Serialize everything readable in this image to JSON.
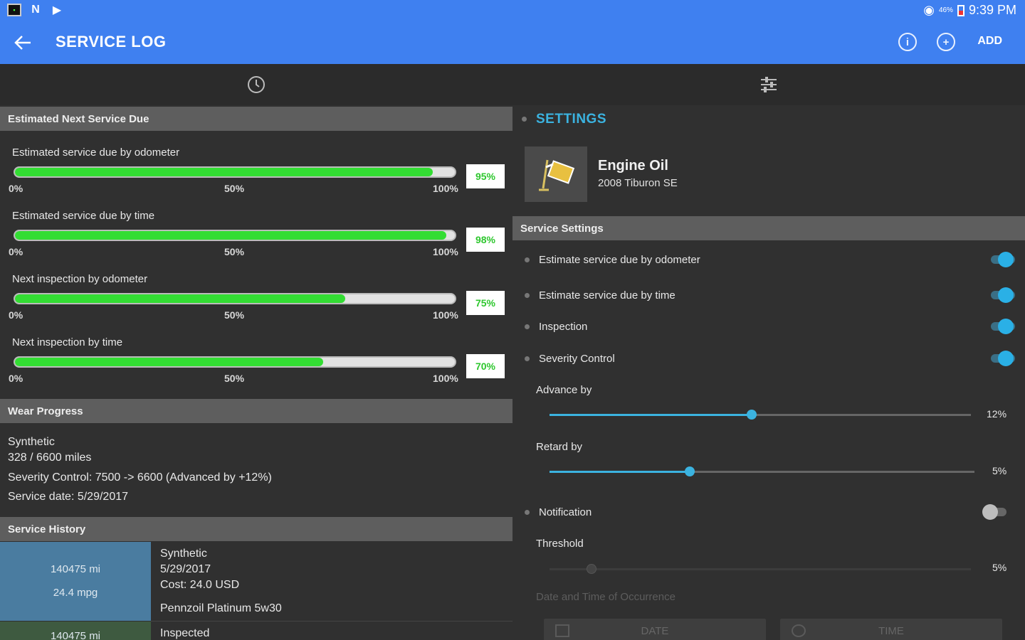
{
  "status_bar": {
    "battery_pct": "46%",
    "time": "9:39 PM"
  },
  "app_bar": {
    "title": "SERVICE LOG",
    "add_label": "ADD",
    "info_icon": "info-icon",
    "add_icon": "add-circle-icon"
  },
  "tabs": [
    {
      "icon": "clock-icon"
    },
    {
      "icon": "sliders-icon"
    }
  ],
  "estimated": {
    "header": "Estimated Next Service Due",
    "ticks": [
      "0%",
      "50%",
      "100%"
    ],
    "bars": [
      {
        "label": "Estimated service due by odometer",
        "value": 0.95,
        "pct": "95%"
      },
      {
        "label": "Estimated service due by time",
        "value": 0.98,
        "pct": "98%"
      },
      {
        "label": "Next inspection by odometer",
        "value": 0.75,
        "pct": "75%"
      },
      {
        "label": "Next inspection by time",
        "value": 0.7,
        "pct": "70%"
      }
    ]
  },
  "wear": {
    "header": "Wear Progress",
    "lines": [
      "Synthetic",
      "328 / 6600 miles",
      "Severity Control: 7500 -> 6600 (Advanced by +12%)",
      "Service date: 5/29/2017"
    ]
  },
  "history": {
    "header": "Service History",
    "entries": [
      {
        "odometer": "140475 mi",
        "mpg": "24.4 mpg",
        "type": "Synthetic",
        "date": "5/29/2017",
        "cost": "Cost: 24.0 USD",
        "product": "Pennzoil Platinum 5w30"
      },
      {
        "odometer": "140475 mi",
        "type": "Inspected"
      }
    ]
  },
  "settings": {
    "title": "SETTINGS",
    "item_name": "Engine Oil",
    "item_vehicle": "2008 Tiburon SE",
    "header": "Service Settings",
    "options": [
      {
        "label": "Estimate service due by odometer",
        "on": true
      },
      {
        "label": "Estimate service due by time",
        "on": true
      },
      {
        "label": "Inspection",
        "on": true
      },
      {
        "label": "Severity Control",
        "on": true
      }
    ],
    "advance": {
      "label": "Advance by",
      "value": 0.48,
      "display": "12%"
    },
    "retard": {
      "label": "Retard by",
      "value": 0.33,
      "display": "5%"
    },
    "notification": {
      "label": "Notification",
      "on": false
    },
    "threshold": {
      "label": "Threshold",
      "value": 0.1,
      "display": "5%"
    },
    "occurrence_label": "Date and Time of Occurrence",
    "date_button": "DATE",
    "time_button": "TIME"
  },
  "colors": {
    "appbar": "#3f80f0",
    "accent": "#3bb3e0",
    "progress": "#33dd33"
  }
}
